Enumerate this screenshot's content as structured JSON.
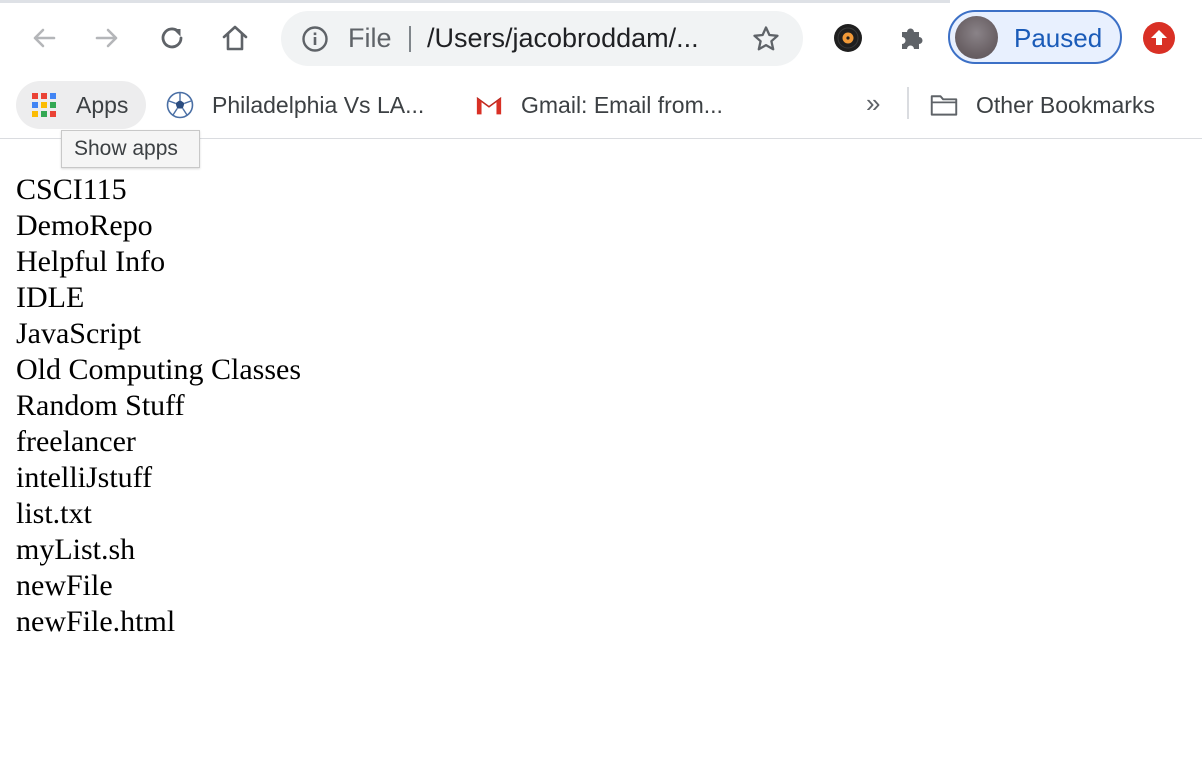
{
  "toolbar": {
    "omnibox": {
      "scheme_label": "File",
      "url_text": "/Users/jacobroddam/..."
    },
    "profile": {
      "status_label": "Paused"
    }
  },
  "bookmarks_bar": {
    "apps_label": "Apps",
    "items": [
      {
        "label": "Philadelphia Vs LA...",
        "icon": "soccer-ball-icon"
      },
      {
        "label": "Gmail: Email from...",
        "icon": "gmail-icon"
      }
    ],
    "overflow_label": "»",
    "other_bookmarks_label": "Other Bookmarks"
  },
  "tooltip": {
    "text": "Show apps"
  },
  "directory_listing": [
    "CSCI115",
    "DemoRepo",
    "Helpful Info",
    "IDLE",
    "JavaScript",
    "Old Computing Classes",
    "Random Stuff",
    "freelancer",
    "intelliJstuff",
    "list.txt",
    "myList.sh",
    "newFile",
    "newFile.html"
  ],
  "colors": {
    "accent_blue": "#1a5bb8",
    "update_red": "#d93025",
    "toolbar_gray": "#5f6368"
  }
}
